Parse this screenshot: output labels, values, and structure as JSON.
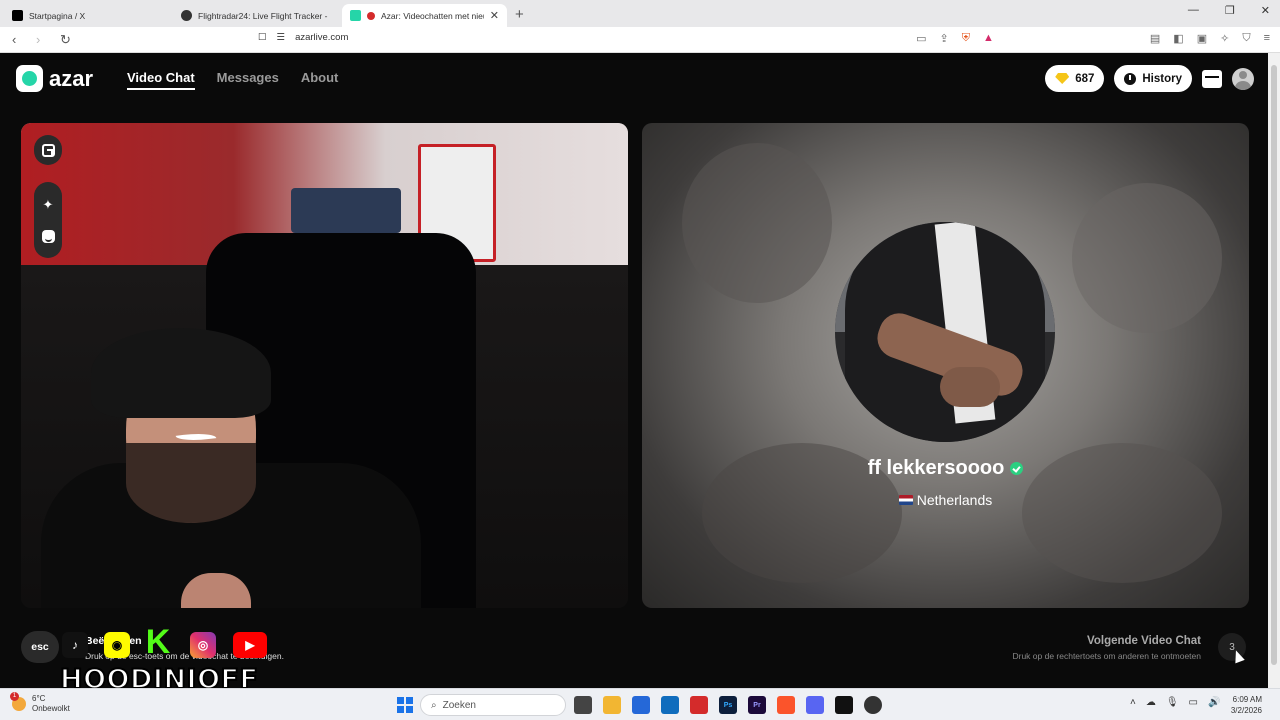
{
  "browser": {
    "tabs": [
      {
        "title": "Startpagina / X",
        "icon": "x-logo-icon",
        "color": "#000000",
        "active": false
      },
      {
        "title": "Flightradar24: Live Flight Tracker - Re",
        "icon": "flightradar-icon",
        "color": "#333333",
        "active": false
      },
      {
        "title": "Azar: Videochatten met nieuw",
        "icon": "azar-icon",
        "color": "#25d5a8",
        "active": true
      }
    ],
    "url": "azarlive.com"
  },
  "app": {
    "logo_text": "azar",
    "nav": [
      "Video Chat",
      "Messages",
      "About"
    ],
    "gems": "687",
    "history_label": "History",
    "accent": "#25d5a8"
  },
  "remote": {
    "username": "ff lekkersoooo",
    "country": "Netherlands"
  },
  "bottom": {
    "esc_label": "esc",
    "esc_title": "Beëindigen",
    "esc_desc": "Druk op de esc-toets om de videochat te beëindigen.",
    "next_title": "Volgende Video Chat",
    "next_desc": "Druk op de rechtertoets om anderen te ontmoeten",
    "next_key": "3"
  },
  "overlay": {
    "handle": "HOODINIOFF",
    "socials": [
      "tiktok-icon",
      "snapchat-icon",
      "kick-icon",
      "instagram-icon",
      "youtube-icon"
    ]
  },
  "taskbar": {
    "temperature": "6°C",
    "weather": "Onbewolkt",
    "search_placeholder": "Zoeken",
    "time": "6:09 AM",
    "date": "3/2/2026"
  }
}
